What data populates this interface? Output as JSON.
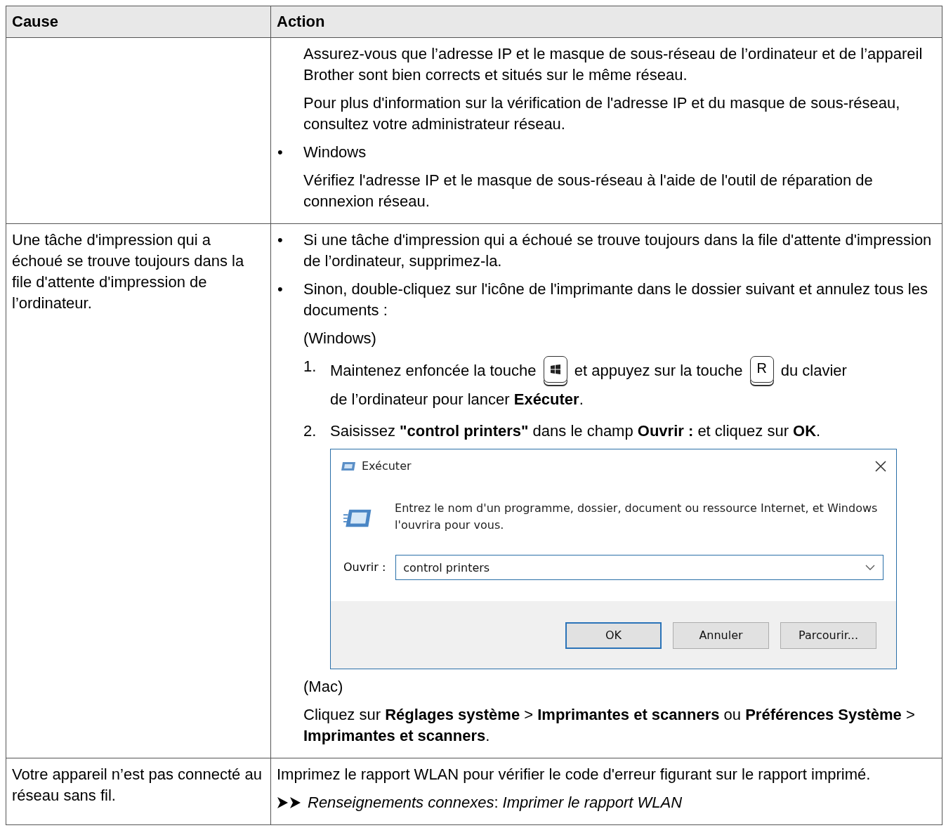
{
  "table": {
    "columns": [
      "Cause",
      "Action"
    ],
    "rows": [
      {
        "cause": "",
        "action": [
          {
            "kind": "para",
            "text": "Assurez-vous que l’adresse IP et le masque de sous-réseau de l’ordinateur et de l’appareil Brother sont bien corrects et situés sur le même réseau."
          },
          {
            "kind": "para",
            "text": "Pour plus d'information sur la vérification de l'adresse IP et du masque de sous-réseau, consultez votre administrateur réseau."
          },
          {
            "kind": "bullet",
            "marker": "•",
            "text": "Windows"
          },
          {
            "kind": "para",
            "text": "Vérifiez l'adresse IP et le masque de sous-réseau à l'aide de l'outil de réparation de connexion réseau."
          }
        ]
      },
      {
        "cause": "Une tâche d'impression qui a échoué se trouve toujours dans la file d'attente d'impression de l’ordinateur.",
        "action": [
          {
            "kind": "bullet",
            "marker": "•",
            "text": "Si une tâche d'impression qui a échoué se trouve toujours dans la file d'attente d'impression de l’ordinateur, supprimez-la."
          },
          {
            "kind": "bullet",
            "marker": "•",
            "text": "Sinon, double-cliquez sur l'icône de l'imprimante dans le dossier suivant et annulez tous les documents :"
          },
          {
            "kind": "para",
            "text": "(Windows)"
          },
          {
            "kind": "step",
            "number": "1.",
            "parts": [
              {
                "kind": "text",
                "text": "Maintenez enfoncée la touche"
              },
              {
                "kind": "winkey"
              },
              {
                "kind": "text",
                "text": "et appuyez sur la touche"
              },
              {
                "kind": "key",
                "label": "R"
              },
              {
                "kind": "text",
                "text": "du clavier"
              },
              {
                "kind": "text",
                "text": "de l’ordinateur pour lancer **Exécuter**."
              }
            ]
          },
          {
            "kind": "step",
            "number": "2.",
            "parts": [
              {
                "kind": "text",
                "text": "Saisissez **\"control printers\"** dans le champ **Ouvrir :** et cliquez sur **OK**."
              }
            ]
          },
          {
            "kind": "dialog",
            "title": "Exécuter",
            "message": "Entrez le nom d'un programme, dossier, document ou ressource Internet, et Windows l'ouvrira pour vous.",
            "field_label": "Ouvrir :",
            "value": "control printers",
            "buttons": [
              {
                "label": "OK",
                "default": true
              },
              {
                "label": "Annuler",
                "default": false
              },
              {
                "label": "Parcourir...",
                "default": false
              }
            ]
          },
          {
            "kind": "para",
            "text": "(Mac)"
          },
          {
            "kind": "para",
            "text": "Cliquez sur **Réglages système** > **Imprimantes et scanners** ou **Préférences Système** > **Imprimantes et scanners**."
          }
        ]
      },
      {
        "cause": "Votre appareil n’est pas connecté au réseau sans fil.",
        "action": [
          {
            "kind": "plain",
            "text": "Imprimez le rapport WLAN pour vérifier le code d'erreur figurant sur le rapport imprimé."
          },
          {
            "kind": "related",
            "label": "*Renseignements connexes*:",
            "link": "Imprimer le rapport WLAN"
          }
        ]
      }
    ]
  }
}
